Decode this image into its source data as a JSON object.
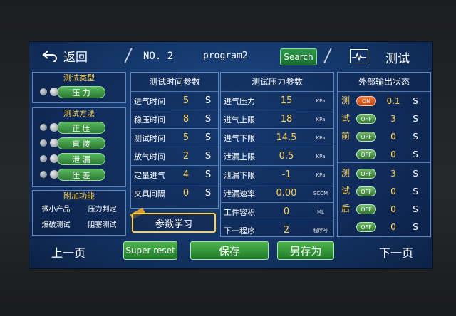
{
  "topbar": {
    "back_label": "返回",
    "program_no": "NO. 2",
    "program_name": "program2",
    "search_label": "Search",
    "mode_title": "测试"
  },
  "test_type": {
    "title": "测试类型",
    "options": [
      "压 力"
    ]
  },
  "test_method": {
    "title": "测试方法",
    "options": [
      "正 压",
      "直 接",
      "泄 漏",
      "压 差"
    ]
  },
  "extra": {
    "title": "附加功能",
    "items": [
      "微小产品",
      "压力判定",
      "爆破测试",
      "阻塞测试"
    ]
  },
  "time_params": {
    "title": "测试时间参数",
    "rows": [
      {
        "label": "进气时间",
        "value": "5",
        "unit": "S"
      },
      {
        "label": "稳压时间",
        "value": "8",
        "unit": "S"
      },
      {
        "label": "测试时间",
        "value": "5",
        "unit": "S"
      },
      {
        "label": "放气时间",
        "value": "2",
        "unit": "S"
      },
      {
        "label": "定量进气",
        "value": "4",
        "unit": "S"
      },
      {
        "label": "夹具间隔",
        "value": "0",
        "unit": "S"
      }
    ],
    "learn_label": "参数学习"
  },
  "pressure_params": {
    "title": "测试压力参数",
    "rows": [
      {
        "label": "进气压力",
        "value": "15",
        "unit": "KPa"
      },
      {
        "label": "进气上限",
        "value": "18",
        "unit": "KPa"
      },
      {
        "label": "进气下限",
        "value": "14.5",
        "unit": "KPa"
      },
      {
        "label": "泄漏上限",
        "value": "0.5",
        "unit": "KPa"
      },
      {
        "label": "泄漏下限",
        "value": "-1",
        "unit": "KPa"
      },
      {
        "label": "泄漏速率",
        "value": "0.00",
        "unit": "SCCM"
      },
      {
        "label": "工件容积",
        "value": "0",
        "unit": "ML"
      },
      {
        "label": "下一程序",
        "value": "2",
        "unit": "程序号"
      }
    ]
  },
  "external": {
    "title": "外部输出状态",
    "before_label": [
      "测",
      "试",
      "前"
    ],
    "after_label": [
      "测",
      "试",
      "后"
    ],
    "before": [
      {
        "state": "ON",
        "value": "0.1",
        "unit": "S"
      },
      {
        "state": "OFF",
        "value": "3",
        "unit": "S"
      },
      {
        "state": "OFF",
        "value": "0",
        "unit": "S"
      },
      {
        "state": "OFF",
        "value": "0",
        "unit": "S"
      }
    ],
    "after": [
      {
        "state": "OFF",
        "value": "3",
        "unit": "S"
      },
      {
        "state": "OFF",
        "value": "0",
        "unit": "S"
      },
      {
        "state": "OFF",
        "value": "0",
        "unit": "S"
      },
      {
        "state": "OFF",
        "value": "0",
        "unit": "S"
      }
    ]
  },
  "bottom": {
    "prev": "上一页",
    "super_reset": "Super reset",
    "save": "保存",
    "save_as": "另存为",
    "next": "下一页"
  },
  "colors": {
    "accent_yellow": "#ffd24a",
    "button_green": "#2c7a34",
    "on_orange": "#e0642a"
  }
}
